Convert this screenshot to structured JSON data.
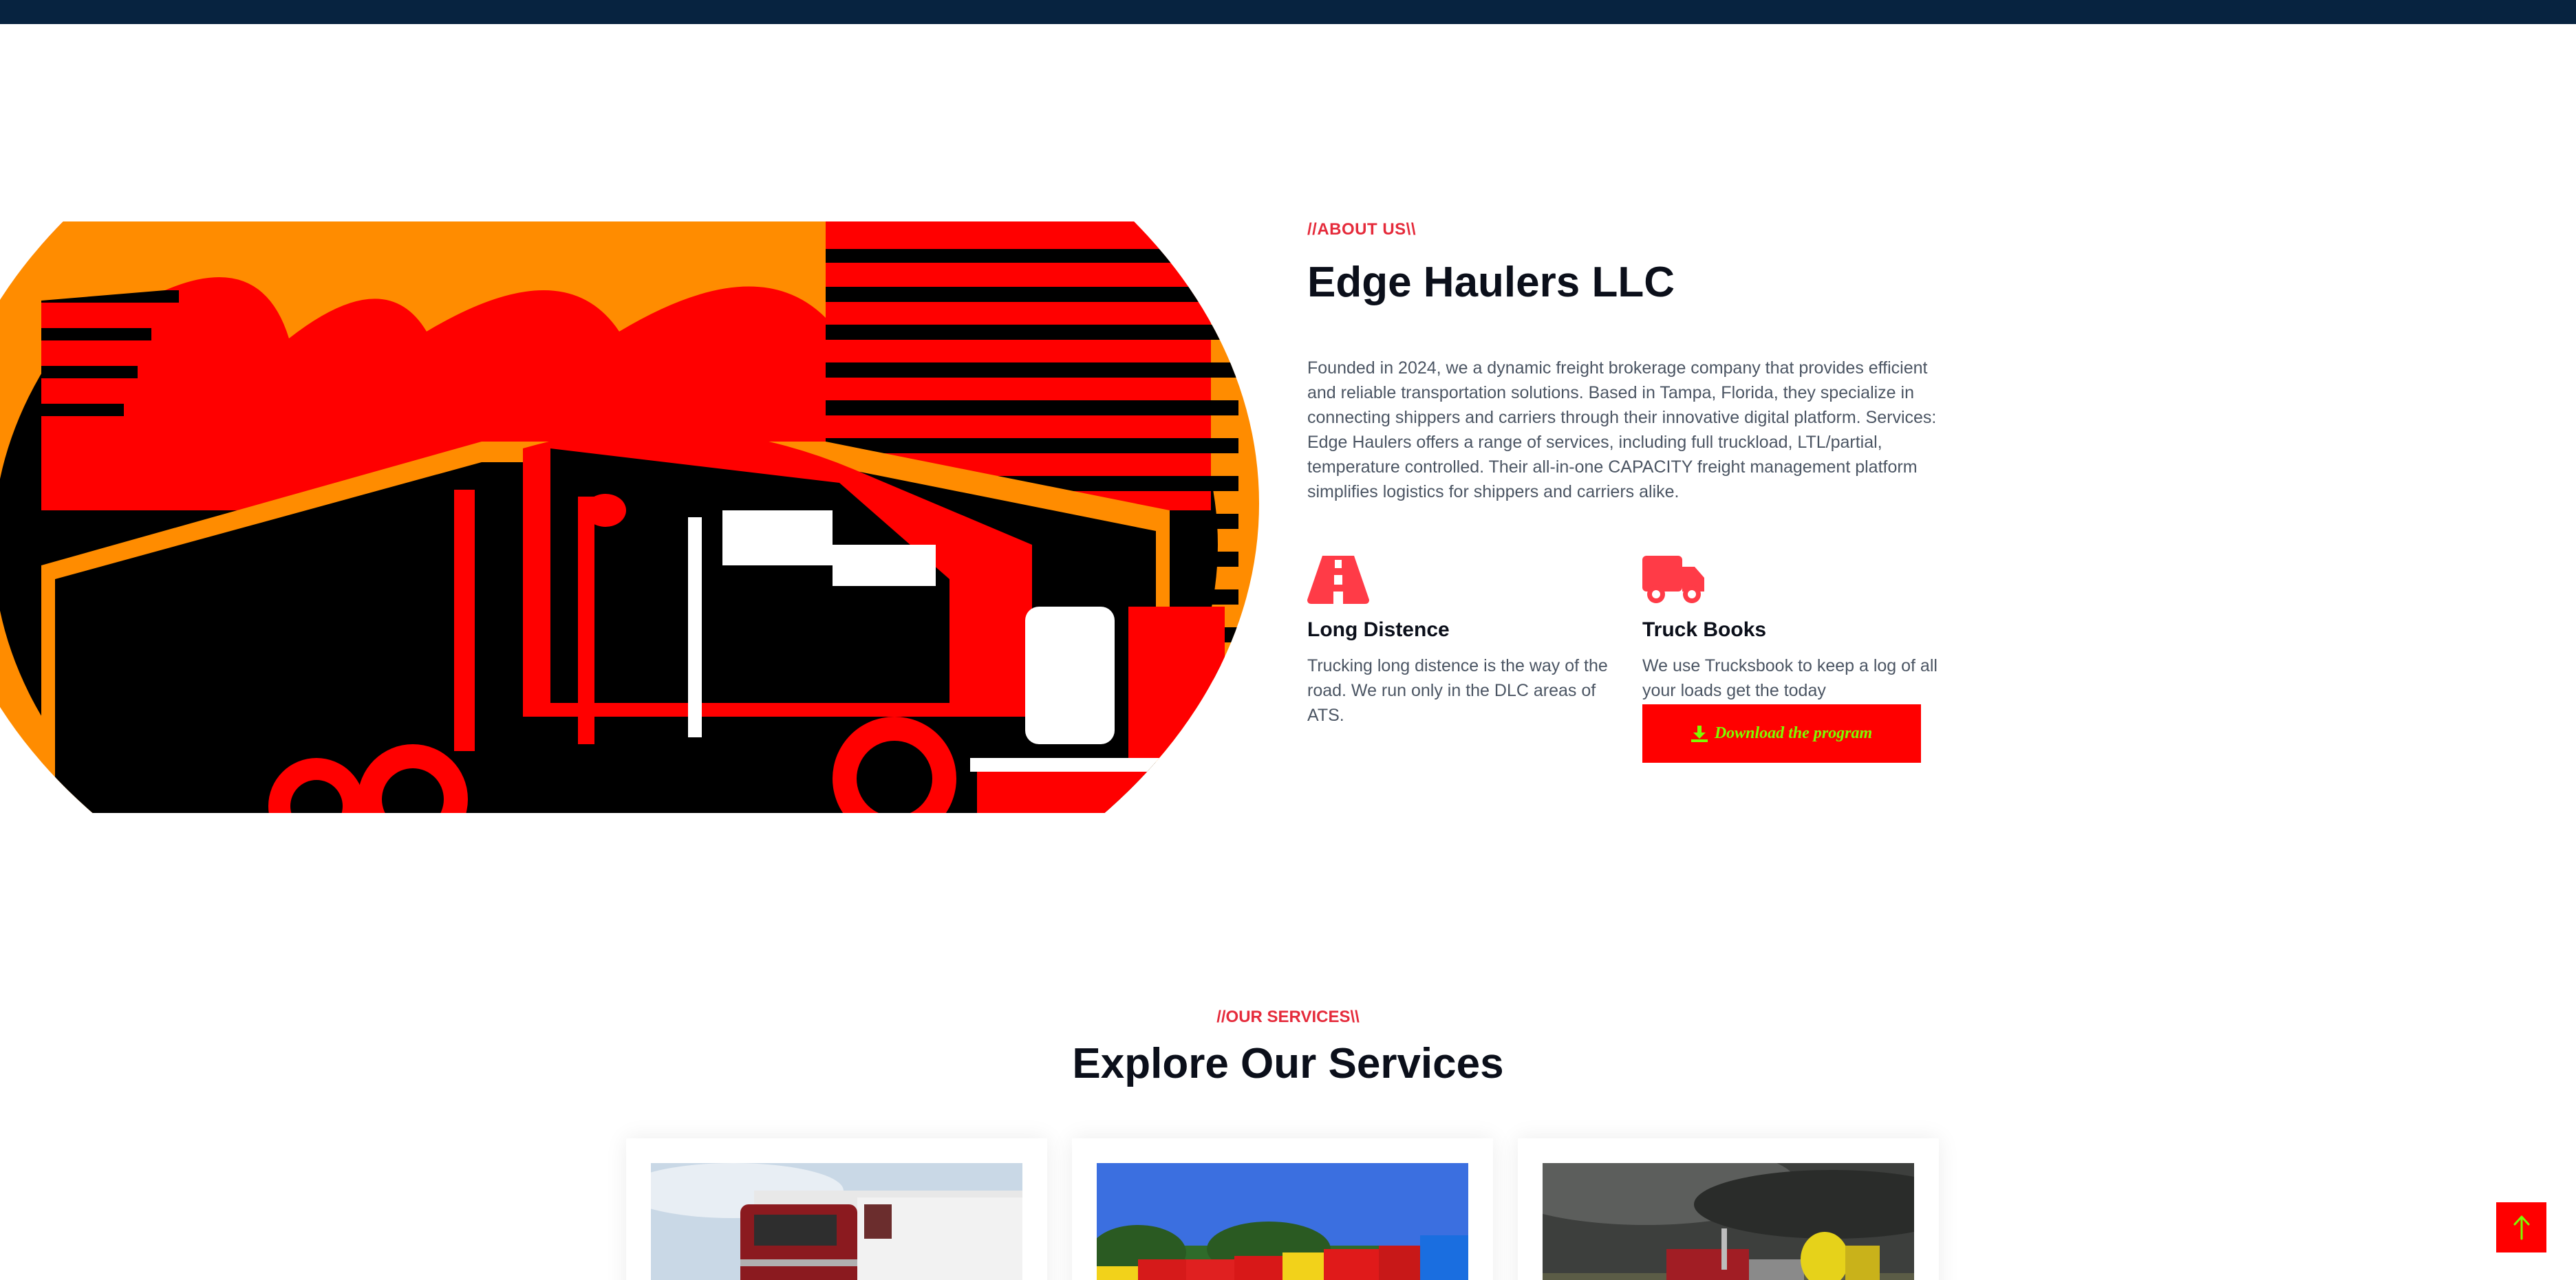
{
  "about": {
    "eyebrow": "//ABOUT US\\\\",
    "title": "Edge Haulers LLC",
    "description": "Founded in 2024, we a dynamic freight brokerage company that provides efficient and reliable transportation solutions. Based in Tampa, Florida, they specialize in connecting shippers and carriers through their innovative digital platform. Services: Edge Haulers offers a range of services, including full truckload, LTL/partial, temperature controlled. Their all-in-one CAPACITY freight management platform simplifies logistics for shippers and carriers alike.",
    "features": [
      {
        "icon": "road-icon",
        "title": "Long Distence",
        "text": "Trucking long distence is the way of the road. We run only in the DLC areas of ATS."
      },
      {
        "icon": "truck-icon",
        "title": "Truck Books",
        "text": "We use Trucksbook to keep a log of all your loads get the today"
      }
    ],
    "download_label": "Download the program"
  },
  "services": {
    "eyebrow": "//OUR SERVICES\\\\",
    "title": "Explore Our Services"
  },
  "colors": {
    "navy": "#072340",
    "accent": "#e52b3b",
    "button_red": "#ff0000",
    "button_text": "#7cfc00"
  },
  "icons": {
    "download": "download-icon",
    "scroll_top": "arrow-up-icon"
  }
}
